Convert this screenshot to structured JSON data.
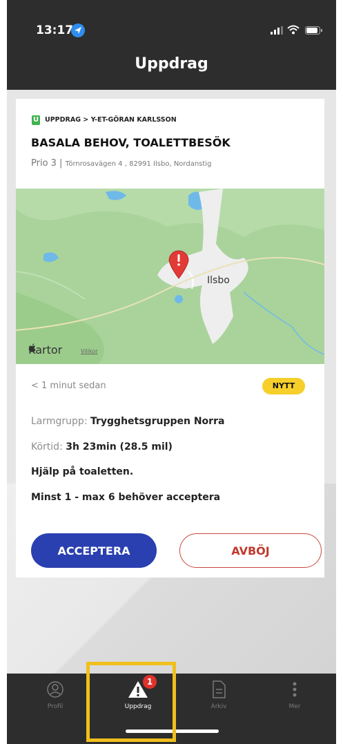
{
  "status_bar": {
    "time": "13:17"
  },
  "header": {
    "title": "Uppdrag"
  },
  "card": {
    "badge": "U",
    "breadcrumb": "UPPDRAG > Y-ET-GÖRAN KARLSSON",
    "title": "BASALA BEHOV, TOALETTBESÖK",
    "prio": "Prio 3 |",
    "address": "Törnrosavägen 4 , 82991 Ilsbo, Nordanstig"
  },
  "map": {
    "attribution": "Kartor",
    "legal": "Villkor",
    "place_label": "Ilsbo"
  },
  "details": {
    "time_ago": "< 1 minut sedan",
    "status_badge": "NYTT",
    "larmgrupp_label": "Larmgrupp: ",
    "larmgrupp_value": "Trygghetsgruppen Norra",
    "kortid_label": "Körtid: ",
    "kortid_value": "3h 23min (28.5 mil)",
    "note": "Hjälp på toaletten.",
    "accept_rule": "Minst 1 - max 6 behöver acceptera"
  },
  "actions": {
    "accept": "ACCEPTERA",
    "decline": "AVBÖJ"
  },
  "tabbar": {
    "items": [
      {
        "label": "Profil",
        "icon": "profile-icon"
      },
      {
        "label": "Uppdrag",
        "icon": "alert-triangle-icon",
        "badge": "1"
      },
      {
        "label": "Arkiv",
        "icon": "document-icon"
      },
      {
        "label": "Mer",
        "icon": "more-icon"
      }
    ]
  },
  "colors": {
    "accent": "#2a3fb0",
    "decline": "#c0392b",
    "new_badge": "#f6cf2a",
    "highlight": "#f0bf1c"
  }
}
